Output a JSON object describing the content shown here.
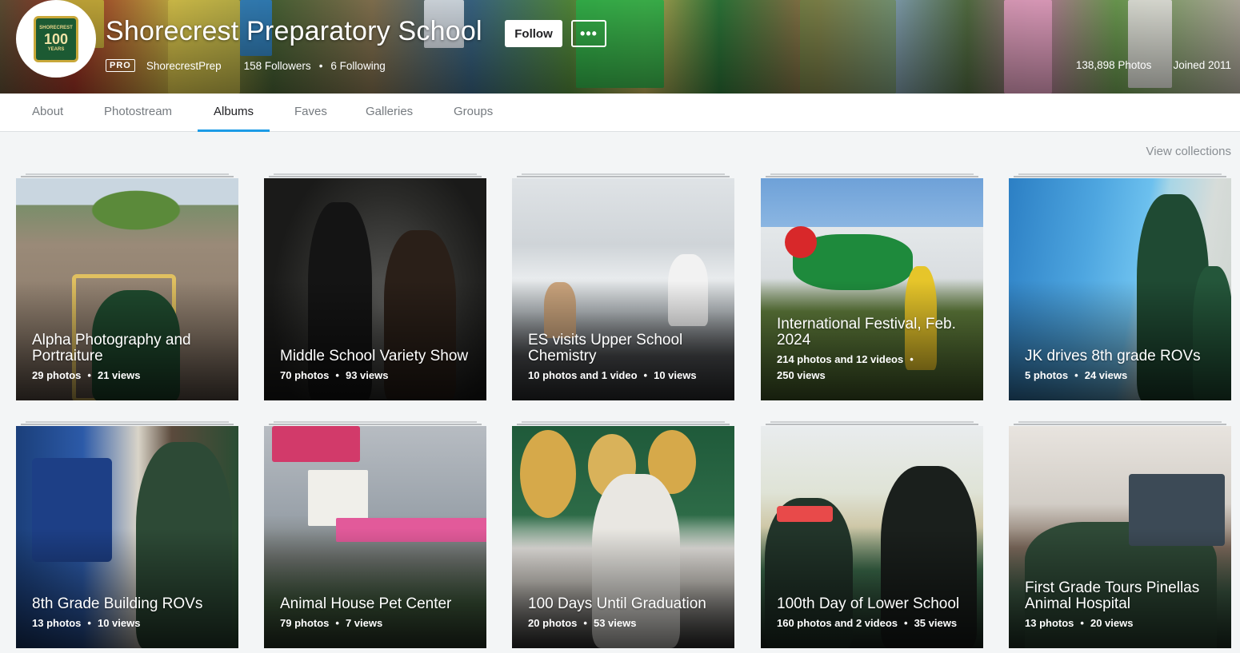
{
  "profile": {
    "name": "Shorecrest Preparatory School",
    "follow_label": "Follow",
    "more_label": "•••",
    "pro_label": "PRO",
    "username": "ShorecrestPrep",
    "followers": "158 Followers",
    "following": "6 Following",
    "photos": "138,898 Photos",
    "joined": "Joined 2011",
    "logo_top": "SHORECREST",
    "logo_number": "100",
    "logo_years": "YEARS"
  },
  "tabs": [
    {
      "label": "About"
    },
    {
      "label": "Photostream"
    },
    {
      "label": "Albums"
    },
    {
      "label": "Faves"
    },
    {
      "label": "Galleries"
    },
    {
      "label": "Groups"
    }
  ],
  "active_tab": "Albums",
  "view_collections": "View collections",
  "albums": [
    {
      "title": "Alpha Photography and Portraiture",
      "count": "29 photos",
      "views": "21 views"
    },
    {
      "title": "Middle School Variety Show",
      "count": "70 photos",
      "views": "93 views"
    },
    {
      "title": "ES visits Upper School Chemistry",
      "count": "10 photos and 1 video",
      "views": "10 views"
    },
    {
      "title": "International Festival, Feb. 2024",
      "count": "214 photos and 12 videos",
      "views": "250 views"
    },
    {
      "title": "JK drives 8th grade ROVs",
      "count": "5 photos",
      "views": "24 views"
    },
    {
      "title": "8th Grade Building ROVs",
      "count": "13 photos",
      "views": "10 views"
    },
    {
      "title": "Animal House Pet Center",
      "count": "79 photos",
      "views": "7 views"
    },
    {
      "title": "100 Days Until Graduation",
      "count": "20 photos",
      "views": "53 views"
    },
    {
      "title": "100th Day of Lower School",
      "count": "160 photos and 2 videos",
      "views": "35 views"
    },
    {
      "title": "First Grade Tours Pinellas Animal Hospital",
      "count": "13 photos",
      "views": "20 views"
    }
  ],
  "colors": {
    "accent": "#1c9be6",
    "text": "#212124",
    "muted": "#767b80",
    "bg": "#f3f5f6"
  }
}
